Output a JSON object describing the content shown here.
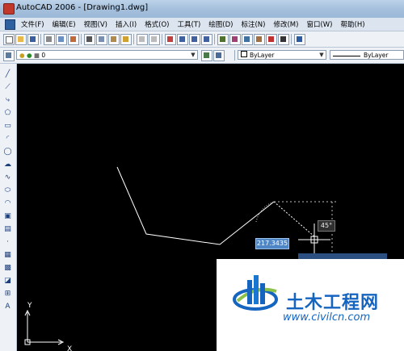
{
  "window": {
    "title": "AutoCAD 2006 - [Drawing1.dwg]"
  },
  "menu": {
    "items": [
      "文件(F)",
      "编辑(E)",
      "视图(V)",
      "插入(I)",
      "格式(O)",
      "工具(T)",
      "绘图(D)",
      "标注(N)",
      "修改(M)",
      "窗口(W)",
      "帮助(H)"
    ]
  },
  "layers": {
    "current_layer": "0",
    "color": "ByLayer",
    "linetype": "ByLayer"
  },
  "canvas": {
    "dynamic_input_value": "217.3435",
    "angle_value": "45°",
    "ucs_x_label": "X",
    "ucs_y_label": "Y",
    "background_color": "#000000",
    "line_color": "#ffffff"
  },
  "watermark": {
    "name": "土木工程网",
    "url": "www.civilcn.com",
    "brand_color": "#1565c0"
  }
}
